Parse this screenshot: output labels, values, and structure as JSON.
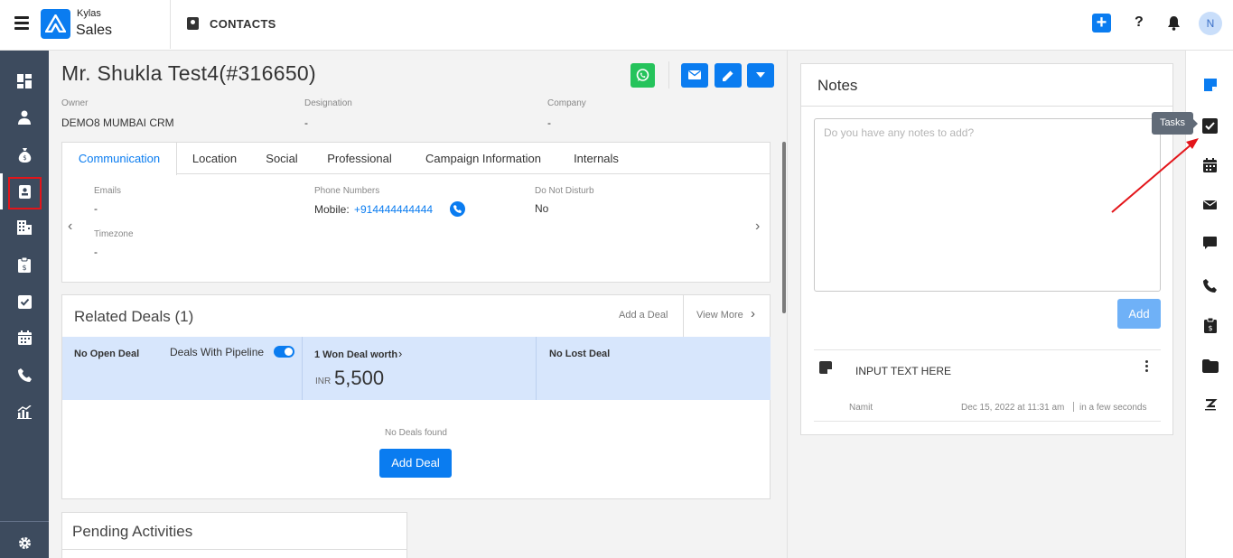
{
  "header": {
    "brand_top": "Kylas",
    "brand_bottom": "Sales",
    "module_title": "CONTACTS",
    "help_label": "?",
    "avatar_initial": "N",
    "plus_label": "+"
  },
  "sidebar": {
    "items": [
      "dashboard-icon",
      "user-icon",
      "money-bag-icon",
      "contact-card-icon",
      "building-icon",
      "clipboard-icon",
      "checkbox-icon",
      "calendar-icon",
      "phone-icon",
      "reports-icon"
    ],
    "settings_icon": "gear-icon"
  },
  "contact": {
    "name": "Mr. Shukla Test4(#316650)",
    "owner_label": "Owner",
    "owner_value": "DEMO8 MUMBAI CRM",
    "designation_label": "Designation",
    "designation_value": "-",
    "company_label": "Company",
    "company_value": "-"
  },
  "tabs": [
    "Communication",
    "Location",
    "Social",
    "Professional",
    "Campaign Information",
    "Internals"
  ],
  "communication": {
    "emails_label": "Emails",
    "emails_value": "-",
    "phone_label": "Phone Numbers",
    "phone_prefix": "Mobile:",
    "phone_value": "+914444444444",
    "dnd_label": "Do Not Disturb",
    "dnd_value": "No",
    "timezone_label": "Timezone",
    "timezone_value": "-"
  },
  "deals": {
    "title": "Related Deals (1)",
    "add_link": "Add a Deal",
    "view_more": "View More",
    "open_label": "No Open Deal",
    "pipeline_label": "Deals With Pipeline",
    "pipeline_toggle": true,
    "won_label": "1 Won Deal worth",
    "currency": "INR",
    "amount": "5,500",
    "lost_label": "No Lost Deal",
    "empty_text": "No Deals found",
    "add_button": "Add Deal"
  },
  "pending": {
    "title": "Pending Activities"
  },
  "notes": {
    "title": "Notes",
    "placeholder": "Do you have any notes to add?",
    "add_button": "Add",
    "item_text": "INPUT TEXT HERE",
    "item_author": "Namit",
    "item_date": "Dec 15, 2022 at 11:31 am",
    "item_relative": "in a few seconds"
  },
  "rail": {
    "items": [
      "note-icon",
      "task-icon",
      "calendar-icon",
      "email-icon",
      "chat-icon",
      "phone-icon",
      "clipboard-icon",
      "folder-icon",
      "zendesk-icon"
    ],
    "tooltip": "Tasks",
    "accent_color": "#0a7cf0"
  }
}
